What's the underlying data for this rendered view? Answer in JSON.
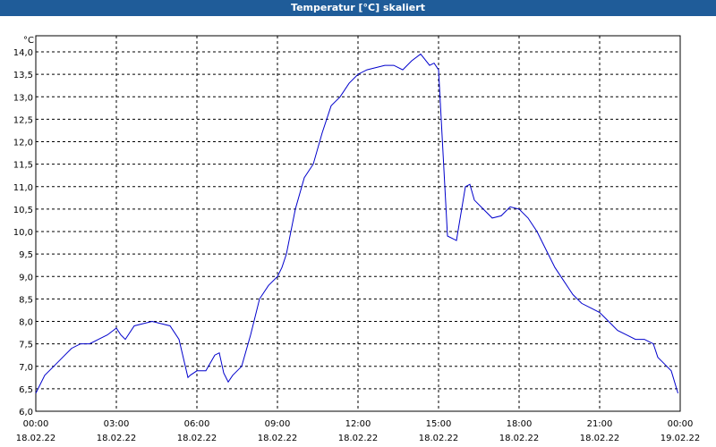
{
  "window": {
    "title": "Temperatur [°C] skaliert"
  },
  "chart_data": {
    "type": "line",
    "title": "Temperatur [°C] skaliert",
    "ylabel": "°C",
    "xlabel": "",
    "ylim": [
      6.0,
      14.0
    ],
    "yticks": [
      "6,0",
      "6,5",
      "7,0",
      "7,5",
      "8,0",
      "8,5",
      "9,0",
      "9,5",
      "10,0",
      "10,5",
      "11,0",
      "11,5",
      "12,0",
      "12,5",
      "13,0",
      "13,5",
      "14,0"
    ],
    "xticks": [
      {
        "time": "00:00",
        "date": "18.02.22"
      },
      {
        "time": "03:00",
        "date": "18.02.22"
      },
      {
        "time": "06:00",
        "date": "18.02.22"
      },
      {
        "time": "09:00",
        "date": "18.02.22"
      },
      {
        "time": "12:00",
        "date": "18.02.22"
      },
      {
        "time": "15:00",
        "date": "18.02.22"
      },
      {
        "time": "18:00",
        "date": "18.02.22"
      },
      {
        "time": "21:00",
        "date": "18.02.22"
      },
      {
        "time": "00:00",
        "date": "19.02.22"
      }
    ],
    "grid": true,
    "line_color": "#0000cc",
    "series": [
      {
        "x": [
          "00:00",
          "00:20",
          "00:40",
          "01:00",
          "01:20",
          "01:40",
          "02:00",
          "02:20",
          "02:40",
          "03:00",
          "03:10",
          "03:20",
          "03:40",
          "04:00",
          "04:20",
          "04:40",
          "05:00",
          "05:20",
          "05:40",
          "05:45",
          "06:00",
          "06:20",
          "06:40",
          "06:50",
          "07:00",
          "07:10",
          "07:20",
          "07:40",
          "08:00",
          "08:20",
          "08:40",
          "09:00",
          "09:10",
          "09:20",
          "09:40",
          "10:00",
          "10:20",
          "10:40",
          "11:00",
          "11:20",
          "11:40",
          "12:00",
          "12:20",
          "12:40",
          "13:00",
          "13:20",
          "13:40",
          "14:00",
          "14:20",
          "14:40",
          "14:50",
          "15:00",
          "15:20",
          "15:40",
          "16:00",
          "16:10",
          "16:20",
          "16:40",
          "17:00",
          "17:20",
          "17:40",
          "18:00",
          "18:20",
          "18:40",
          "19:00",
          "19:20",
          "19:40",
          "20:00",
          "20:20",
          "20:40",
          "21:00",
          "21:20",
          "21:40",
          "22:00",
          "22:20",
          "22:40",
          "23:00",
          "23:10",
          "23:20",
          "23:40",
          "23:55"
        ],
        "y": [
          6.4,
          6.8,
          7.0,
          7.2,
          7.4,
          7.5,
          7.5,
          7.6,
          7.7,
          7.85,
          7.7,
          7.6,
          7.9,
          7.95,
          8.0,
          7.95,
          7.9,
          7.6,
          6.75,
          6.8,
          6.9,
          6.9,
          7.25,
          7.3,
          6.85,
          6.65,
          6.8,
          7.0,
          7.7,
          8.5,
          8.8,
          9.0,
          9.2,
          9.5,
          10.5,
          11.2,
          11.5,
          12.2,
          12.8,
          13.0,
          13.3,
          13.5,
          13.6,
          13.65,
          13.7,
          13.7,
          13.6,
          13.8,
          13.95,
          13.7,
          13.75,
          13.6,
          9.9,
          9.8,
          11.0,
          11.05,
          10.7,
          10.5,
          10.3,
          10.35,
          10.55,
          10.5,
          10.3,
          10.0,
          9.6,
          9.2,
          8.9,
          8.6,
          8.4,
          8.3,
          8.2,
          8.0,
          7.8,
          7.7,
          7.6,
          7.6,
          7.5,
          7.2,
          7.1,
          6.9,
          6.4
        ]
      }
    ]
  }
}
